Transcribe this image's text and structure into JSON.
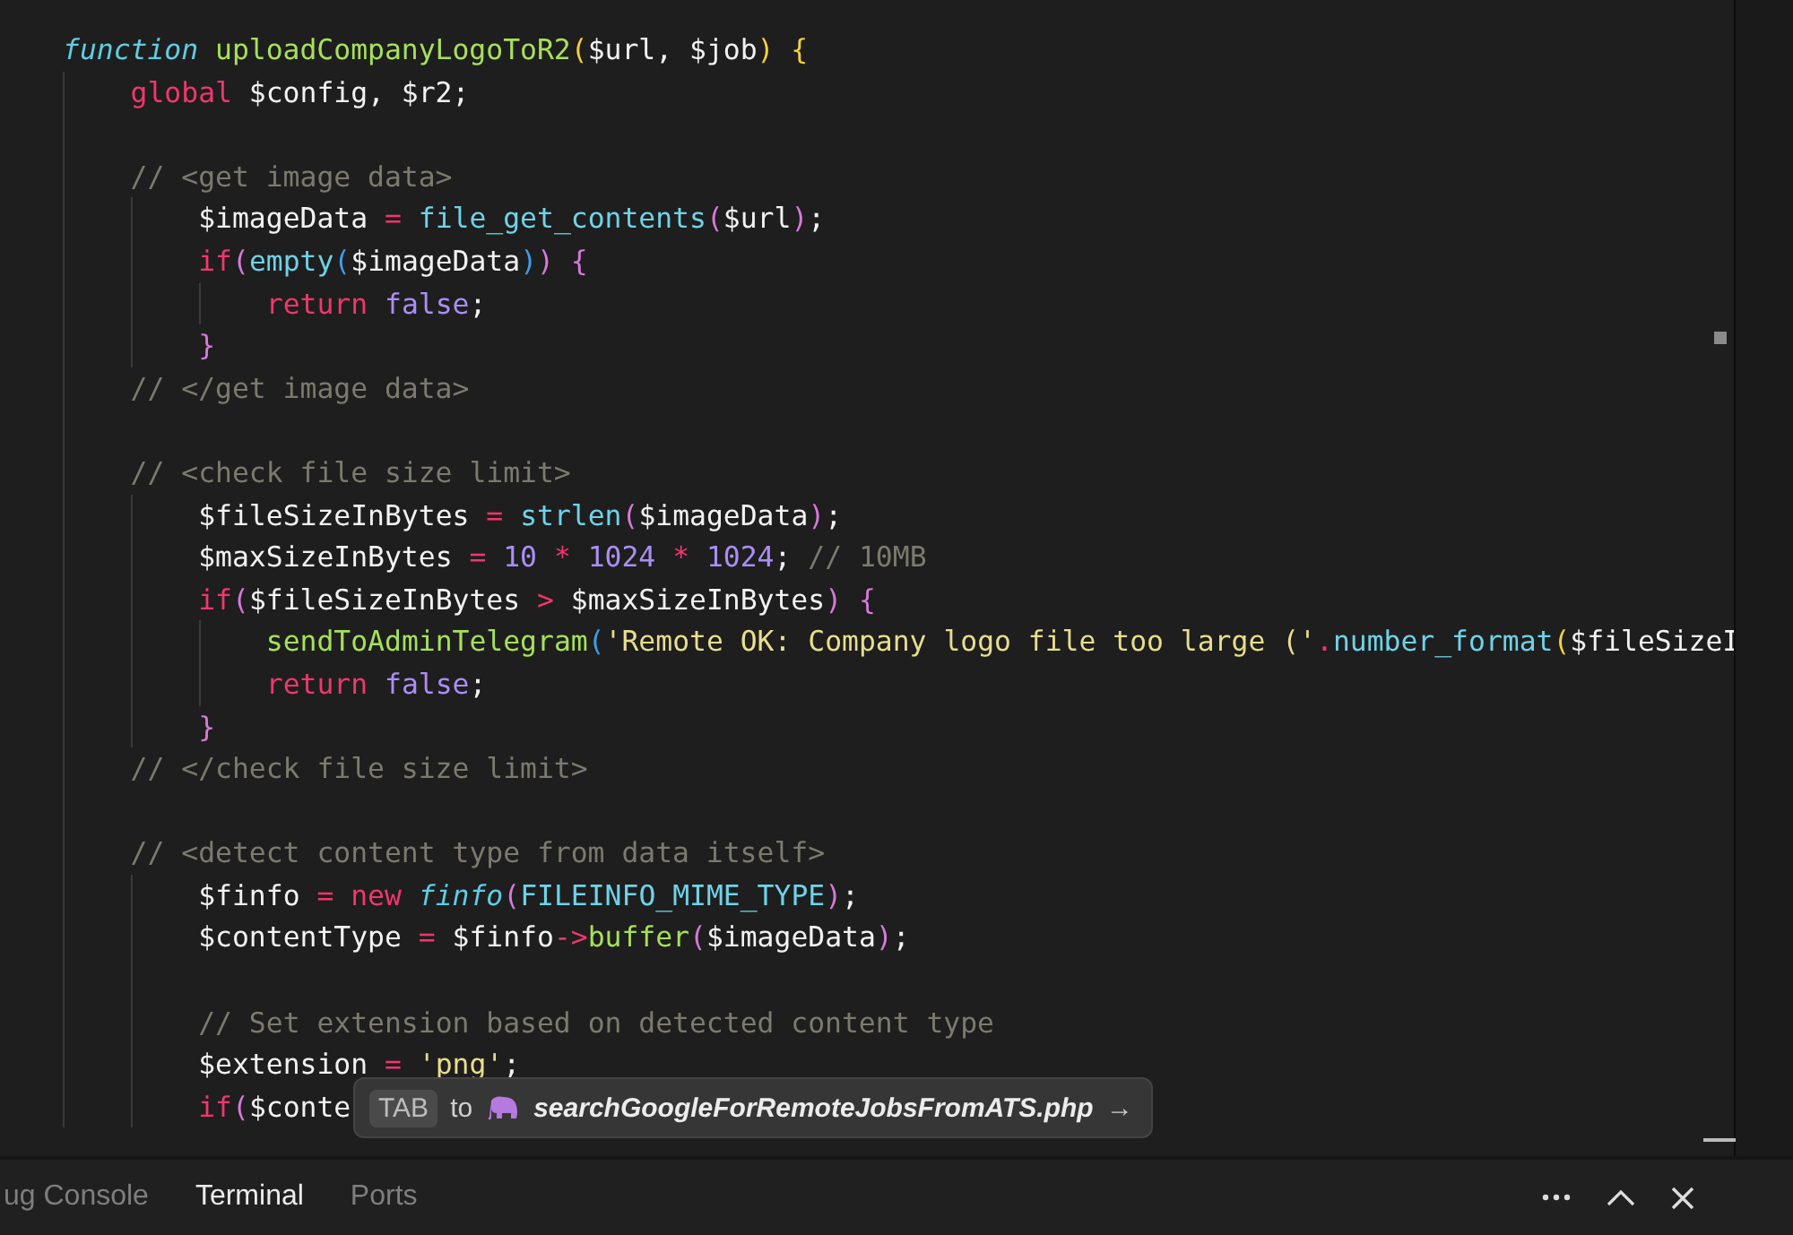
{
  "editor": {
    "lines": [
      {
        "kind": "code",
        "tokens": [
          {
            "text": "function ",
            "kind": "storage"
          },
          {
            "text": "uploadCompanyLogoToR2",
            "kind": "function"
          },
          {
            "text": "(",
            "kind": "b1"
          },
          {
            "text": "$url, $job",
            "kind": "plain"
          },
          {
            "text": ") ",
            "kind": "b1"
          },
          {
            "text": "{",
            "kind": "b1"
          }
        ],
        "children": [
          {
            "kind": "code",
            "tokens": [
              {
                "text": "global",
                "kind": "keyword"
              },
              {
                "text": " $config, $r2;",
                "kind": "plain"
              }
            ]
          },
          {
            "kind": "blank"
          },
          {
            "kind": "code",
            "tokens": [
              {
                "text": "// <get image data>",
                "kind": "comment"
              }
            ],
            "children": [
              {
                "kind": "code",
                "tokens": [
                  {
                    "text": "$imageData",
                    "kind": "plain"
                  },
                  {
                    "text": " = ",
                    "kind": "operator"
                  },
                  {
                    "text": "file_get_contents",
                    "kind": "builtin"
                  },
                  {
                    "text": "(",
                    "kind": "b2"
                  },
                  {
                    "text": "$url",
                    "kind": "plain"
                  },
                  {
                    "text": ")",
                    "kind": "b2"
                  },
                  {
                    "text": ";",
                    "kind": "plain"
                  }
                ]
              },
              {
                "kind": "code",
                "tokens": [
                  {
                    "text": "if",
                    "kind": "keyword"
                  },
                  {
                    "text": "(",
                    "kind": "b2"
                  },
                  {
                    "text": "empty",
                    "kind": "builtin"
                  },
                  {
                    "text": "(",
                    "kind": "b3"
                  },
                  {
                    "text": "$imageData",
                    "kind": "plain"
                  },
                  {
                    "text": ")",
                    "kind": "b3"
                  },
                  {
                    "text": ") ",
                    "kind": "b2"
                  },
                  {
                    "text": "{",
                    "kind": "b2"
                  }
                ],
                "children": [
                  {
                    "kind": "code",
                    "tokens": [
                      {
                        "text": "return ",
                        "kind": "keyword"
                      },
                      {
                        "text": "false",
                        "kind": "number"
                      },
                      {
                        "text": ";",
                        "kind": "plain"
                      }
                    ]
                  }
                ]
              },
              {
                "kind": "code",
                "tokens": [
                  {
                    "text": "}",
                    "kind": "b2"
                  }
                ]
              }
            ]
          },
          {
            "kind": "code",
            "tokens": [
              {
                "text": "// </get image data>",
                "kind": "comment"
              }
            ]
          },
          {
            "kind": "blank"
          },
          {
            "kind": "code",
            "tokens": [
              {
                "text": "// <check file size limit>",
                "kind": "comment"
              }
            ],
            "children": [
              {
                "kind": "code",
                "tokens": [
                  {
                    "text": "$fileSizeInBytes",
                    "kind": "plain"
                  },
                  {
                    "text": " = ",
                    "kind": "operator"
                  },
                  {
                    "text": "strlen",
                    "kind": "builtin"
                  },
                  {
                    "text": "(",
                    "kind": "b2"
                  },
                  {
                    "text": "$imageData",
                    "kind": "plain"
                  },
                  {
                    "text": ")",
                    "kind": "b2"
                  },
                  {
                    "text": ";",
                    "kind": "plain"
                  }
                ]
              },
              {
                "kind": "code",
                "tokens": [
                  {
                    "text": "$maxSizeInBytes",
                    "kind": "plain"
                  },
                  {
                    "text": " = ",
                    "kind": "operator"
                  },
                  {
                    "text": "10",
                    "kind": "number"
                  },
                  {
                    "text": " * ",
                    "kind": "operator"
                  },
                  {
                    "text": "1024",
                    "kind": "number"
                  },
                  {
                    "text": " * ",
                    "kind": "operator"
                  },
                  {
                    "text": "1024",
                    "kind": "number"
                  },
                  {
                    "text": ";",
                    "kind": "plain"
                  },
                  {
                    "text": " // 10MB",
                    "kind": "comment"
                  }
                ]
              },
              {
                "kind": "code",
                "tokens": [
                  {
                    "text": "if",
                    "kind": "keyword"
                  },
                  {
                    "text": "(",
                    "kind": "b2"
                  },
                  {
                    "text": "$fileSizeInBytes",
                    "kind": "plain"
                  },
                  {
                    "text": " > ",
                    "kind": "operator"
                  },
                  {
                    "text": "$maxSizeInBytes",
                    "kind": "plain"
                  },
                  {
                    "text": ") ",
                    "kind": "b2"
                  },
                  {
                    "text": "{",
                    "kind": "b2"
                  }
                ],
                "children": [
                  {
                    "kind": "code",
                    "tokens": [
                      {
                        "text": "sendToAdminTelegram",
                        "kind": "function"
                      },
                      {
                        "text": "(",
                        "kind": "b3"
                      },
                      {
                        "text": "'Remote OK: Company logo file too large ('",
                        "kind": "string"
                      },
                      {
                        "text": ".",
                        "kind": "operator"
                      },
                      {
                        "text": "number_format",
                        "kind": "builtin"
                      },
                      {
                        "text": "(",
                        "kind": "b1"
                      },
                      {
                        "text": "$fileSizeI",
                        "kind": "plain"
                      }
                    ]
                  },
                  {
                    "kind": "code",
                    "tokens": [
                      {
                        "text": "return ",
                        "kind": "keyword"
                      },
                      {
                        "text": "false",
                        "kind": "number"
                      },
                      {
                        "text": ";",
                        "kind": "plain"
                      }
                    ]
                  }
                ]
              },
              {
                "kind": "code",
                "tokens": [
                  {
                    "text": "}",
                    "kind": "b2"
                  }
                ]
              }
            ]
          },
          {
            "kind": "code",
            "tokens": [
              {
                "text": "// </check file size limit>",
                "kind": "comment"
              }
            ]
          },
          {
            "kind": "blank"
          },
          {
            "kind": "code",
            "tokens": [
              {
                "text": "// <detect content type from data itself>",
                "kind": "comment"
              }
            ],
            "children": [
              {
                "kind": "code",
                "tokens": [
                  {
                    "text": "$finfo",
                    "kind": "plain"
                  },
                  {
                    "text": " = ",
                    "kind": "operator"
                  },
                  {
                    "text": "new ",
                    "kind": "keyword"
                  },
                  {
                    "text": "finfo",
                    "kind": "class"
                  },
                  {
                    "text": "(",
                    "kind": "b2"
                  },
                  {
                    "text": "FILEINFO_MIME_TYPE",
                    "kind": "builtin"
                  },
                  {
                    "text": ")",
                    "kind": "b2"
                  },
                  {
                    "text": ";",
                    "kind": "plain"
                  }
                ]
              },
              {
                "kind": "code",
                "tokens": [
                  {
                    "text": "$contentType",
                    "kind": "plain"
                  },
                  {
                    "text": " = ",
                    "kind": "operator"
                  },
                  {
                    "text": "$finfo",
                    "kind": "plain"
                  },
                  {
                    "text": "->",
                    "kind": "operator"
                  },
                  {
                    "text": "buffer",
                    "kind": "function"
                  },
                  {
                    "text": "(",
                    "kind": "b2"
                  },
                  {
                    "text": "$imageData",
                    "kind": "plain"
                  },
                  {
                    "text": ")",
                    "kind": "b2"
                  },
                  {
                    "text": ";",
                    "kind": "plain"
                  }
                ]
              },
              {
                "kind": "blank"
              },
              {
                "kind": "code",
                "tokens": [
                  {
                    "text": "// Set extension based on detected content type",
                    "kind": "comment"
                  }
                ]
              },
              {
                "kind": "code",
                "tokens": [
                  {
                    "text": "$extension",
                    "kind": "plain"
                  },
                  {
                    "text": " = ",
                    "kind": "operator"
                  },
                  {
                    "text": "'png'",
                    "kind": "string"
                  },
                  {
                    "text": ";",
                    "kind": "plain"
                  }
                ]
              },
              {
                "kind": "code",
                "tokens": [
                  {
                    "text": "if",
                    "kind": "keyword"
                  },
                  {
                    "text": "(",
                    "kind": "b2"
                  },
                  {
                    "text": "$conte",
                    "kind": "plain"
                  }
                ]
              }
            ]
          }
        ]
      }
    ]
  },
  "suggestion": {
    "key": "TAB",
    "connector": "to",
    "file": "searchGoogleForRemoteJobsFromATS.php",
    "arrow": "→"
  },
  "panel": {
    "tabs": [
      {
        "label": "ug Console",
        "selected": false
      },
      {
        "label": "Terminal",
        "selected": true
      },
      {
        "label": "Ports",
        "selected": false
      }
    ]
  }
}
